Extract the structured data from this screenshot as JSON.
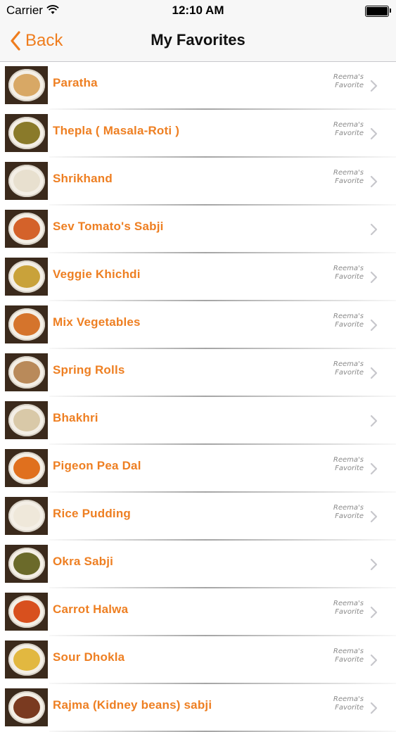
{
  "status_bar": {
    "carrier": "Carrier",
    "time": "12:10 AM"
  },
  "nav": {
    "back_label": "Back",
    "title": "My Favorites"
  },
  "colors": {
    "accent": "#ee7f22"
  },
  "items": [
    {
      "title": "Paratha",
      "badge_line1": "Reema's",
      "badge_line2": "Favorite",
      "food": "#d8a865"
    },
    {
      "title": "Thepla ( Masala-Roti )",
      "badge_line1": "Reema's",
      "badge_line2": "Favorite",
      "food": "#8a7a2a"
    },
    {
      "title": "Shrikhand",
      "badge_line1": "Reema's",
      "badge_line2": "Favorite",
      "food": "#e8e0cf"
    },
    {
      "title": "Sev Tomato's Sabji",
      "badge_line1": "",
      "badge_line2": "",
      "food": "#d4622a"
    },
    {
      "title": "Veggie Khichdi",
      "badge_line1": "Reema's",
      "badge_line2": "Favorite",
      "food": "#c9a23a"
    },
    {
      "title": "Mix Vegetables",
      "badge_line1": "Reema's",
      "badge_line2": "Favorite",
      "food": "#d5742c"
    },
    {
      "title": "Spring Rolls",
      "badge_line1": "Reema's",
      "badge_line2": "Favorite",
      "food": "#b98a5a"
    },
    {
      "title": "Bhakhri",
      "badge_line1": "",
      "badge_line2": "",
      "food": "#d9c9a8"
    },
    {
      "title": "Pigeon Pea Dal",
      "badge_line1": "Reema's",
      "badge_line2": "Favorite",
      "food": "#e0701e"
    },
    {
      "title": "Rice Pudding",
      "badge_line1": "Reema's",
      "badge_line2": "Favorite",
      "food": "#efe8da"
    },
    {
      "title": "Okra Sabji",
      "badge_line1": "",
      "badge_line2": "",
      "food": "#6b6a2a"
    },
    {
      "title": "Carrot Halwa",
      "badge_line1": "Reema's",
      "badge_line2": "Favorite",
      "food": "#d8501e"
    },
    {
      "title": "Sour Dhokla",
      "badge_line1": "Reema's",
      "badge_line2": "Favorite",
      "food": "#e2b840"
    },
    {
      "title": "Rajma (Kidney beans) sabji",
      "badge_line1": "Reema's",
      "badge_line2": "Favorite",
      "food": "#7a3a20"
    }
  ]
}
